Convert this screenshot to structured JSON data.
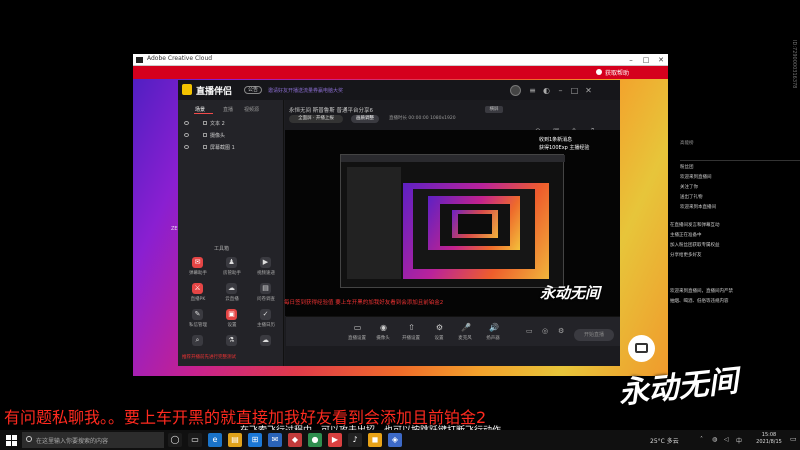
{
  "acc": {
    "title": "Adobe Creative Cloud",
    "help": "获取帮助",
    "watermark": "ZE"
  },
  "zb": {
    "app_name": "直播伴侣",
    "badge": "公告",
    "notice": "邀请好友开播送流量券赢电脑大奖",
    "tabs": [
      "场景",
      "直播",
      "视频源"
    ],
    "sources": [
      "文本 2",
      "摄像头",
      "屏幕截图 1"
    ],
    "tools_title": "工具箱",
    "tools": [
      {
        "label": "弹幕助手",
        "icon": "✉"
      },
      {
        "label": "房管助手",
        "icon": "♟"
      },
      {
        "label": "视频速递",
        "icon": "▶"
      },
      {
        "label": "直播PK",
        "icon": "⚔"
      },
      {
        "label": "云直播",
        "icon": "☁"
      },
      {
        "label": "问卷调查",
        "icon": "▤"
      },
      {
        "label": "私信管理",
        "icon": "✎"
      },
      {
        "label": "设置",
        "icon": "▣"
      },
      {
        "label": "主播日历",
        "icon": "✓"
      },
      {
        "label": "搜索",
        "icon": "⌕"
      },
      {
        "label": "实验室",
        "icon": "⚗"
      },
      {
        "label": "更多",
        "icon": "☁"
      }
    ],
    "bottom_warning": "推荐开播前先进行完整测试",
    "scene_header": "永恒无间  斯普鲁斯 普通平台分享6",
    "scene_tag": "横屏",
    "mode_pill": "全面屏 · 开播上报",
    "quality_pill": "画质调整",
    "stream_info": "直播时长 00:00:00  1080x1920",
    "preview_text_1": "收到1条新消息",
    "preview_text_2": "获得100Exp 主播经验",
    "danmu": "每日签到获得经验值    要上车开黑的加我好友看到会添加且前铂金2",
    "bottom_buttons": [
      {
        "label": "直播设置",
        "icon": "▭"
      },
      {
        "label": "摄像头",
        "icon": "◉"
      },
      {
        "label": "开播设置",
        "icon": "⇧"
      },
      {
        "label": "设置",
        "icon": "⚙"
      },
      {
        "label": "麦克风",
        "icon": "🎤"
      },
      {
        "label": "扬声器",
        "icon": "🔊"
      }
    ],
    "start_button": "开始直播"
  },
  "chat": {
    "lines": [
      "高能榜",
      "粉丝团",
      "欢迎来到直播间",
      "关注了你",
      "送出了礼物",
      "欢迎来到本直播间",
      "在直播间发言和弹幕互动",
      "主播正在准备中",
      "加入粉丝团获取专属权益",
      "分享给更多好友",
      "欢迎来到直播间，直播间内严禁",
      "抽烟、喝酒、低俗等违规内容"
    ],
    "vertical_id": "ID:7290000316378"
  },
  "overlay": {
    "logo_small": "永动无间",
    "logo_big": "永动无间",
    "marquee": "有问题私聊我。。要上车开黑的就直接加我好友看到会添加且前铂金2",
    "subtitle": "在飞索飞行过程中，可以攻击出招，也可以按跳跃键打断飞行动作。"
  },
  "taskbar": {
    "search_placeholder": "在这里输入你要搜索的内容",
    "weather": "25°C 多云",
    "time": "15:08",
    "date": "2021/8/15",
    "apps": [
      {
        "icon": "◯",
        "color": "#1b1b1b"
      },
      {
        "icon": "▭",
        "color": "#1b1b1b"
      },
      {
        "icon": "e",
        "color": "#1a73c8"
      },
      {
        "icon": "▤",
        "color": "#e0a21a"
      },
      {
        "icon": "⊞",
        "color": "#1b78d6"
      },
      {
        "icon": "✉",
        "color": "#2a63b8"
      },
      {
        "icon": "◆",
        "color": "#c23b3b"
      },
      {
        "icon": "●",
        "color": "#2f8f4f"
      },
      {
        "icon": "▶",
        "color": "#d94040"
      },
      {
        "icon": "♪",
        "color": "#222"
      },
      {
        "icon": "◼",
        "color": "#e8a317"
      },
      {
        "icon": "◈",
        "color": "#3d6ac8"
      }
    ]
  }
}
